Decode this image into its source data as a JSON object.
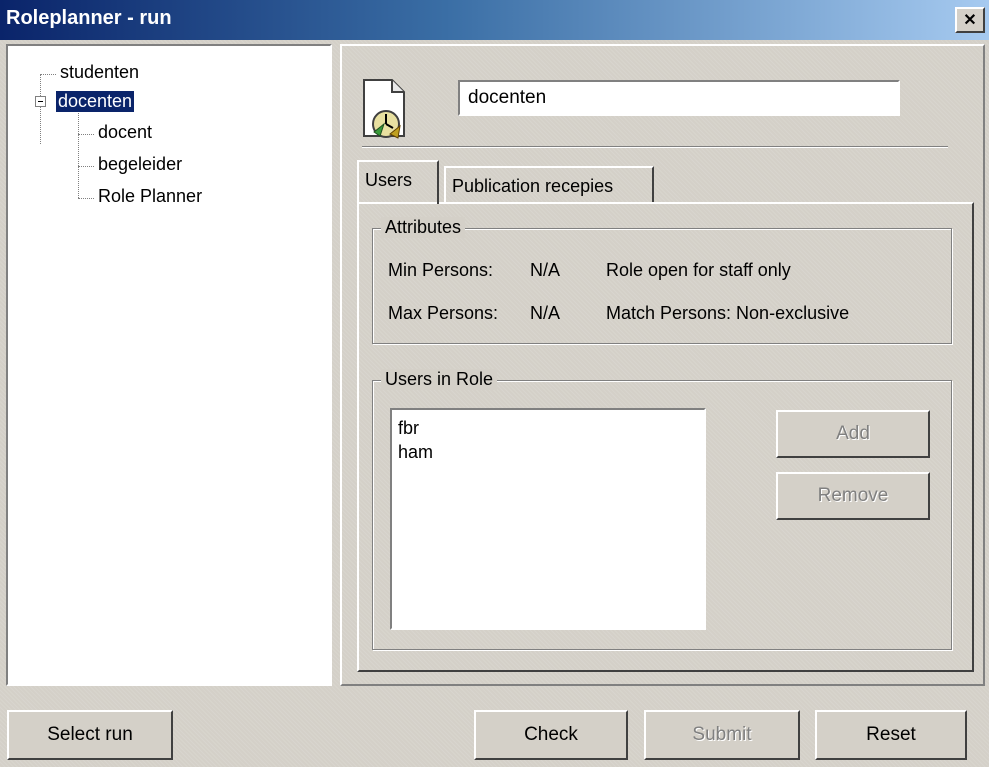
{
  "window": {
    "title": "Roleplanner - run",
    "close_glyph": "✕"
  },
  "tree": {
    "items": [
      {
        "label": "studenten",
        "level": 0
      },
      {
        "label": "docenten",
        "level": 0,
        "expanded": true,
        "selected": true
      },
      {
        "label": "docent",
        "level": 1
      },
      {
        "label": "begeleider",
        "level": 1
      },
      {
        "label": "Role Planner",
        "level": 1
      }
    ]
  },
  "detail": {
    "role_icon": "role-clock-document-icon",
    "role_name": "docenten"
  },
  "tabs": [
    {
      "label": "Users",
      "active": true
    },
    {
      "label": "Publication recepies",
      "active": false
    }
  ],
  "attributes": {
    "legend": "Attributes",
    "min_label": "Min Persons:",
    "min_value": "N/A",
    "max_label": "Max Persons:",
    "max_value": "N/A",
    "open_text": "Role open for staff only",
    "match_text": "Match Persons: Non-exclusive"
  },
  "users_in_role": {
    "legend": "Users in Role",
    "users": [
      "fbr",
      "ham"
    ],
    "add_label": "Add",
    "remove_label": "Remove"
  },
  "bottom": {
    "select_run": "Select run",
    "check": "Check",
    "submit": "Submit",
    "reset": "Reset"
  },
  "colors": {
    "title_start": "#0a246a",
    "title_end": "#a6caf0",
    "selection": "#0a246a",
    "face": "#d4d0c8"
  }
}
